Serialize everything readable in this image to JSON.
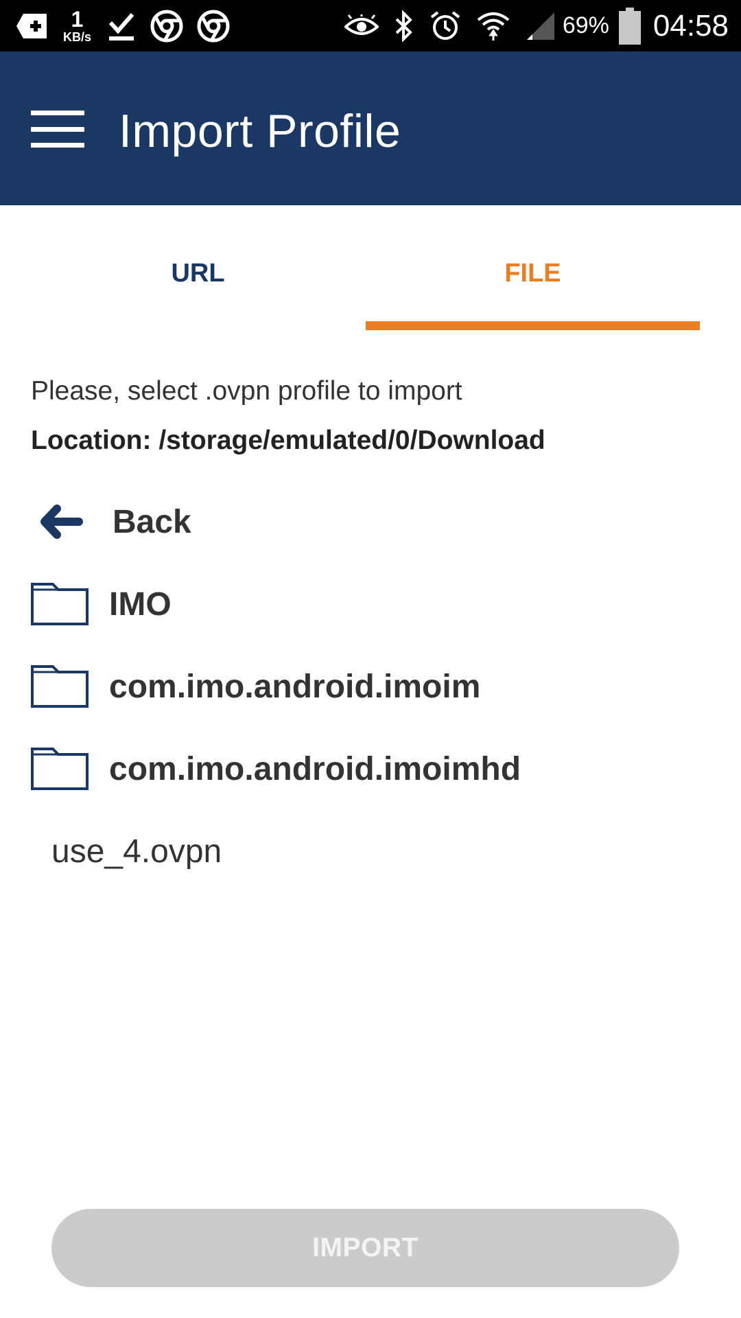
{
  "status_bar": {
    "network_speed_value": "1",
    "network_speed_unit": "KB/s",
    "battery_percent": "69%",
    "time": "04:58",
    "left_icons": [
      "add-notification-icon",
      "download-done-icon",
      "chrome-icon",
      "chrome-icon"
    ],
    "right_icons": [
      "eye-icon",
      "bluetooth-icon",
      "alarm-icon",
      "wifi-icon",
      "cell-signal-icon",
      "battery-icon"
    ]
  },
  "app_bar": {
    "title": "Import Profile",
    "background": "#1b3764"
  },
  "tabs": [
    {
      "label": "URL",
      "selected": false
    },
    {
      "label": "FILE",
      "selected": true
    }
  ],
  "file_browser": {
    "instruction": "Please, select .ovpn profile to import",
    "location": "Location: /storage/emulated/0/Download",
    "back_label": "Back",
    "folders": [
      {
        "name": "IMO"
      },
      {
        "name": "com.imo.android.imoim"
      },
      {
        "name": "com.imo.android.imoimhd"
      }
    ],
    "files": [
      {
        "name": "use_4.ovpn"
      }
    ]
  },
  "import_button": {
    "label": "IMPORT",
    "enabled": false
  },
  "colors": {
    "primary": "#1b3764",
    "accent": "#ea7e25",
    "disabled_button": "#cbcbcb"
  }
}
